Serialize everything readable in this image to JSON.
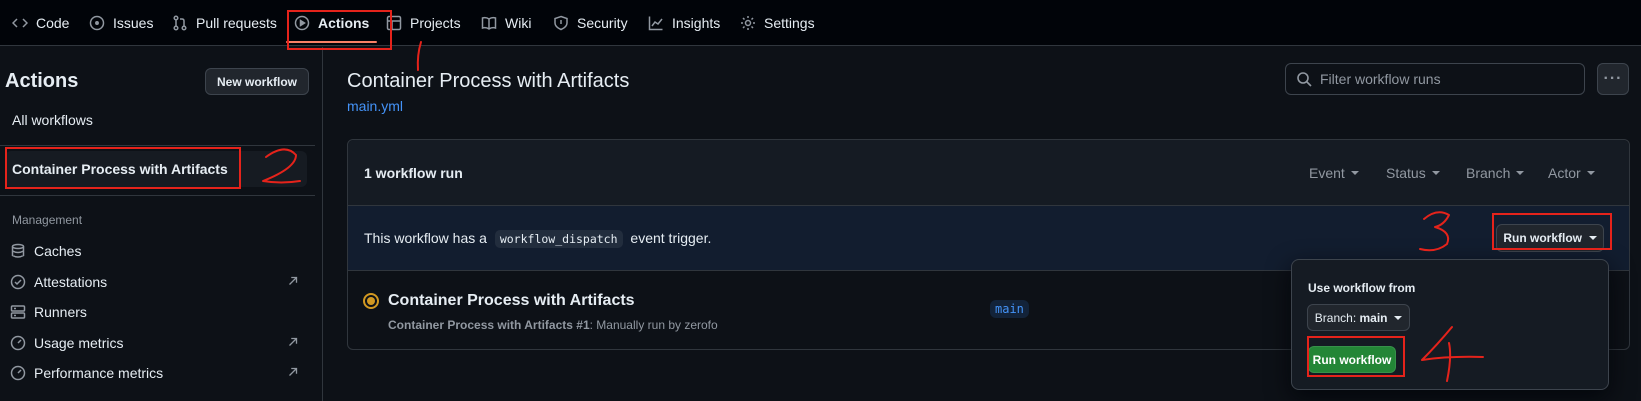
{
  "nav": {
    "tabs": [
      {
        "label": "Code",
        "icon": "code-icon"
      },
      {
        "label": "Issues",
        "icon": "issue-icon"
      },
      {
        "label": "Pull requests",
        "icon": "pull-request-icon"
      },
      {
        "label": "Actions",
        "icon": "play-icon",
        "active": true
      },
      {
        "label": "Projects",
        "icon": "table-icon"
      },
      {
        "label": "Wiki",
        "icon": "book-icon"
      },
      {
        "label": "Security",
        "icon": "shield-icon"
      },
      {
        "label": "Insights",
        "icon": "graph-icon"
      },
      {
        "label": "Settings",
        "icon": "gear-icon"
      }
    ]
  },
  "sidebar": {
    "title": "Actions",
    "new_workflow_label": "New workflow",
    "all_workflows_label": "All workflows",
    "selected_workflow_label": "Container Process with Artifacts",
    "management_label": "Management",
    "management_items": [
      {
        "label": "Caches",
        "icon": "database-icon",
        "external": false
      },
      {
        "label": "Attestations",
        "icon": "verified-icon",
        "external": true
      },
      {
        "label": "Runners",
        "icon": "server-icon",
        "external": false
      },
      {
        "label": "Usage metrics",
        "icon": "meter-icon",
        "external": true
      },
      {
        "label": "Performance metrics",
        "icon": "meter-icon",
        "external": true
      }
    ]
  },
  "main": {
    "title": "Container Process with Artifacts",
    "file_link": "main.yml",
    "filter_placeholder": "Filter workflow runs",
    "run_count": "1 workflow run",
    "filters": [
      "Event",
      "Status",
      "Branch",
      "Actor"
    ],
    "dispatch": {
      "prefix": "This workflow has a",
      "code": "workflow_dispatch",
      "suffix": "event trigger.",
      "button_label": "Run workflow"
    },
    "run": {
      "title": "Container Process with Artifacts",
      "subtitle_bold": "Container Process with Artifacts #1",
      "subtitle_rest": ": Manually run by zerofo",
      "branch": "main"
    }
  },
  "popover": {
    "label": "Use workflow from",
    "branch_prefix": "Branch:",
    "branch_value": "main",
    "run_button_label": "Run workflow"
  },
  "annotations": [
    "1",
    "2",
    "3",
    "4"
  ],
  "colors": {
    "accent_blue": "#4493f8",
    "green_button": "#238636",
    "annotation_red": "#e5231b",
    "status_yellow": "#d29922"
  }
}
